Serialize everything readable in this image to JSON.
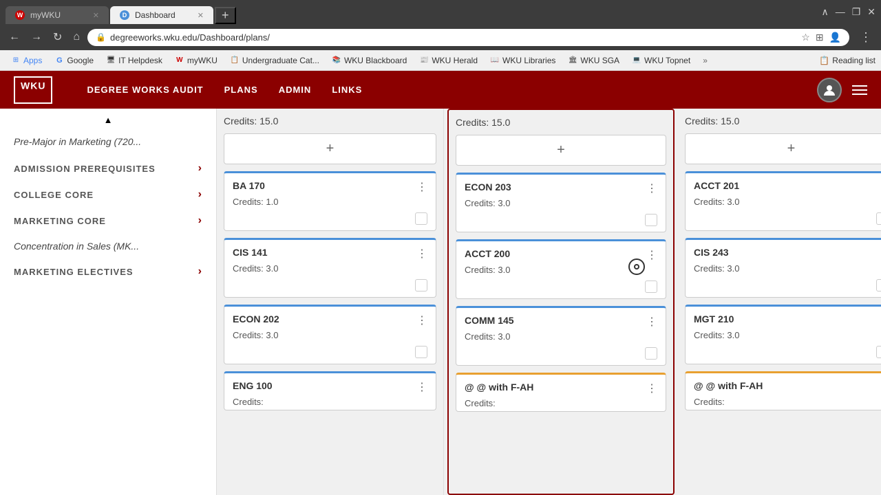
{
  "browser": {
    "tabs": [
      {
        "id": "tab1",
        "label": "myWKU",
        "icon": "W",
        "icon_color": "#cc0000",
        "active": false
      },
      {
        "id": "tab2",
        "label": "Dashboard",
        "icon": "D",
        "icon_color": "#4a90d9",
        "active": true
      }
    ],
    "address": "degreeworks.wku.edu/Dashboard/plans/",
    "bookmarks": [
      {
        "label": "Apps",
        "type": "apps"
      },
      {
        "label": "Google",
        "type": "google"
      },
      {
        "label": "IT Helpdesk",
        "type": "it"
      },
      {
        "label": "myWKU",
        "type": "mywku"
      },
      {
        "label": "Undergraduate Cat...",
        "type": "ug"
      },
      {
        "label": "WKU Blackboard",
        "type": "blackboard"
      },
      {
        "label": "WKU Herald",
        "type": "herald"
      },
      {
        "label": "WKU Libraries",
        "type": "libraries"
      },
      {
        "label": "WKU SGA",
        "type": "sga"
      },
      {
        "label": "WKU Topnet",
        "type": "topnet"
      }
    ],
    "reading_list": "Reading list"
  },
  "header": {
    "logo": "WKU",
    "nav": [
      "DEGREE WORKS AUDIT",
      "PLANS",
      "ADMIN",
      "LINKS"
    ]
  },
  "sidebar": {
    "scroll_up": "▲",
    "pre_major": "Pre-Major in Marketing (720...",
    "sections": [
      {
        "label": "ADMISSION PREREQUISITES",
        "has_chevron": true
      },
      {
        "label": "COLLEGE CORE",
        "has_chevron": true
      },
      {
        "label": "MARKETING CORE",
        "has_chevron": true
      }
    ],
    "concentration": "Concentration in Sales (MK...",
    "marketing_electives": "Marketing Electives",
    "marketing_chevron": true
  },
  "columns": [
    {
      "credits_label": "Credits:",
      "credits_value": "15.0",
      "highlighted": false,
      "courses": [
        {
          "code": "BA 170",
          "credits": "Credits: 1.0",
          "border": "blue"
        },
        {
          "code": "CIS 141",
          "credits": "Credits: 3.0",
          "border": "blue"
        },
        {
          "code": "ECON 202",
          "credits": "Credits: 3.0",
          "border": "blue"
        },
        {
          "code": "ENG 100",
          "credits": "Credits:",
          "border": "blue"
        }
      ]
    },
    {
      "credits_label": "Credits:",
      "credits_value": "15.0",
      "highlighted": true,
      "courses": [
        {
          "code": "ECON 203",
          "credits": "Credits: 3.0",
          "border": "blue"
        },
        {
          "code": "ACCT 200",
          "credits": "Credits: 3.0",
          "border": "blue"
        },
        {
          "code": "COMM 145",
          "credits": "Credits: 3.0",
          "border": "blue"
        },
        {
          "code": "@ @ with F-AH",
          "credits": "Credits:",
          "border": "orange"
        }
      ]
    },
    {
      "credits_label": "Credits:",
      "credits_value": "15.0",
      "highlighted": false,
      "courses": [
        {
          "code": "ACCT 201",
          "credits": "Credits: 3.0",
          "border": "blue"
        },
        {
          "code": "CIS 243",
          "credits": "Credits: 3.0",
          "border": "blue"
        },
        {
          "code": "MGT 210",
          "credits": "Credits: 3.0",
          "border": "blue"
        },
        {
          "code": "@ @ with F-AH",
          "credits": "Credits:",
          "border": "orange"
        }
      ]
    }
  ],
  "icons": {
    "more_vert": "⋮",
    "plus": "+",
    "chevron_right": "›",
    "lock": "⊘"
  }
}
